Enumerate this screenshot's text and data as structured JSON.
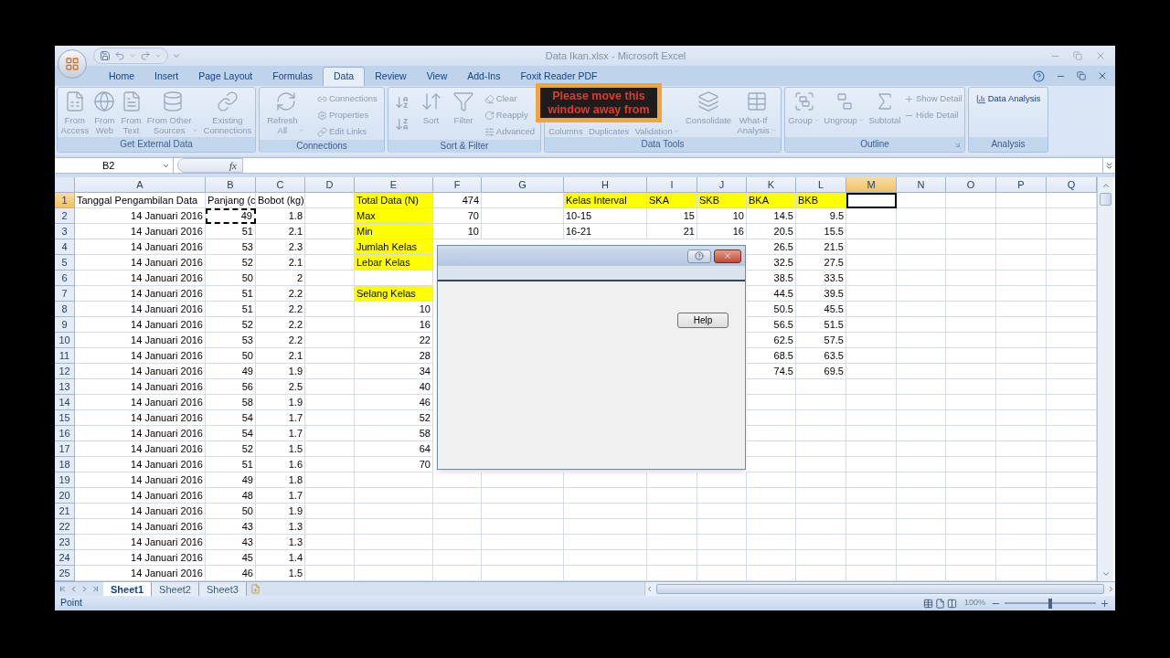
{
  "window": {
    "title": "Data Ikan.xlsx - Microsoft Excel"
  },
  "tabs": [
    {
      "label": "Home",
      "selected": false
    },
    {
      "label": "Insert",
      "selected": false
    },
    {
      "label": "Page Layout",
      "selected": false
    },
    {
      "label": "Formulas",
      "selected": false
    },
    {
      "label": "Data",
      "selected": true
    },
    {
      "label": "Review",
      "selected": false
    },
    {
      "label": "View",
      "selected": false
    },
    {
      "label": "Add-Ins",
      "selected": false
    },
    {
      "label": "Foxit Reader PDF",
      "selected": false
    }
  ],
  "ribbon": {
    "groups": [
      {
        "label": "Get External Data",
        "disabled": true,
        "items": [
          {
            "kind": "large",
            "label": "From\nAccess"
          },
          {
            "kind": "large",
            "label": "From\nWeb"
          },
          {
            "kind": "large",
            "label": "From\nText"
          },
          {
            "kind": "large",
            "label": "From Other\nSources",
            "menu": true
          },
          {
            "kind": "large",
            "label": "Existing\nConnections"
          }
        ]
      },
      {
        "label": "Connections",
        "disabled": true,
        "items": [
          {
            "kind": "large",
            "label": "Refresh\nAll",
            "menu": true
          },
          {
            "kind": "stack",
            "entries": [
              "Connections",
              "Properties",
              "Edit Links"
            ]
          }
        ]
      },
      {
        "label": "Sort & Filter",
        "disabled": true,
        "items": [
          {
            "kind": "sortpair"
          },
          {
            "kind": "large",
            "label": "Sort"
          },
          {
            "kind": "large",
            "label": "Filter"
          },
          {
            "kind": "stack",
            "entries": [
              "Clear",
              "Reapply",
              "Advanced"
            ]
          }
        ]
      },
      {
        "label": "Data Tools",
        "disabled": true,
        "items": [
          {
            "kind": "label",
            "label": "Columns"
          },
          {
            "kind": "label",
            "label": "Duplicates"
          },
          {
            "kind": "label",
            "label": "Validation",
            "menu": true
          },
          {
            "kind": "large",
            "label": "Consolidate"
          },
          {
            "kind": "large",
            "label": "What-If\nAnalysis",
            "menu": true
          }
        ]
      },
      {
        "label": "Outline",
        "disabled": true,
        "items": [
          {
            "kind": "large",
            "label": "Group",
            "menu": true
          },
          {
            "kind": "large",
            "label": "Ungroup",
            "menu": true
          },
          {
            "kind": "large",
            "label": "Subtotal"
          },
          {
            "kind": "stack",
            "entries": [
              "Show Detail",
              "Hide Detail"
            ]
          }
        ]
      },
      {
        "label": "Analysis",
        "disabled": false,
        "items": [
          {
            "kind": "stack",
            "entries": [
              "Data Analysis"
            ]
          }
        ]
      }
    ]
  },
  "overlay": {
    "lines": [
      "Please move this",
      "window away from"
    ]
  },
  "formula_bar": {
    "name_box": "B2",
    "function_label": "fx"
  },
  "columns": [
    {
      "label": "A",
      "selected": false
    },
    {
      "label": "B",
      "selected": false
    },
    {
      "label": "C",
      "selected": false
    },
    {
      "label": "D",
      "selected": false
    },
    {
      "label": "E",
      "selected": false
    },
    {
      "label": "F",
      "selected": false
    },
    {
      "label": "G",
      "selected": false
    },
    {
      "label": "H",
      "selected": false
    },
    {
      "label": "I",
      "selected": false
    },
    {
      "label": "J",
      "selected": false
    },
    {
      "label": "K",
      "selected": false
    },
    {
      "label": "L",
      "selected": false
    },
    {
      "label": "M",
      "selected": true
    },
    {
      "label": "N",
      "selected": false
    },
    {
      "label": "O",
      "selected": false
    },
    {
      "label": "P",
      "selected": false
    },
    {
      "label": "Q",
      "selected": false
    }
  ],
  "rows": [
    {
      "header": "1",
      "selected": true,
      "cells": [
        {
          "text": "Tanggal Pengambilan Data",
          "kind": "text"
        },
        {
          "text": "Panjang (c",
          "kind": "text"
        },
        {
          "text": "Bobot (kg)",
          "kind": "text"
        },
        null,
        {
          "text": "Total Data (N)",
          "kind": "text",
          "color": "#ffff00"
        },
        {
          "text": "474",
          "kind": "number"
        },
        null,
        {
          "text": "Kelas Interval",
          "kind": "text",
          "color": "#ffff00"
        },
        {
          "text": "SKA",
          "kind": "text",
          "color": "#ffff00"
        },
        {
          "text": "SKB",
          "kind": "text",
          "color": "#ffff00"
        },
        {
          "text": "BKA",
          "kind": "text",
          "color": "#ffff00"
        },
        {
          "text": "BKB",
          "kind": "text",
          "color": "#ffff00"
        },
        {
          "active": true
        }
      ]
    },
    {
      "header": "2",
      "selected": false,
      "cells": [
        {
          "text": "14 Januari 2016",
          "kind": "number"
        },
        {
          "text": "49",
          "kind": "number",
          "copied": true
        },
        {
          "text": "1.8",
          "kind": "number"
        },
        null,
        {
          "text": "Max",
          "kind": "text",
          "color": "#ffff00"
        },
        {
          "text": "70",
          "kind": "number"
        },
        null,
        {
          "text": "10-15",
          "kind": "text"
        },
        {
          "text": "15",
          "kind": "number"
        },
        {
          "text": "10",
          "kind": "number"
        },
        {
          "text": "14.5",
          "kind": "number"
        },
        {
          "text": "9.5",
          "kind": "number"
        }
      ]
    },
    {
      "header": "3",
      "selected": false,
      "cells": [
        {
          "text": "14 Januari 2016",
          "kind": "number"
        },
        {
          "text": "51",
          "kind": "number"
        },
        {
          "text": "2.1",
          "kind": "number"
        },
        null,
        {
          "text": "Min",
          "kind": "text",
          "color": "#ffff00"
        },
        {
          "text": "10",
          "kind": "number"
        },
        null,
        {
          "text": "16-21",
          "kind": "text"
        },
        {
          "text": "21",
          "kind": "number"
        },
        {
          "text": "16",
          "kind": "number"
        },
        {
          "text": "20.5",
          "kind": "number"
        },
        {
          "text": "15.5",
          "kind": "number"
        }
      ]
    },
    {
      "header": "4",
      "selected": false,
      "cells": [
        {
          "text": "14 Januari 2016",
          "kind": "number"
        },
        {
          "text": "53",
          "kind": "number"
        },
        {
          "text": "2.3",
          "kind": "number"
        },
        null,
        {
          "text": "Jumlah Kelas",
          "kind": "text",
          "color": "#ffff00"
        },
        null,
        null,
        null,
        null,
        null,
        {
          "text": "26.5",
          "kind": "number"
        },
        {
          "text": "21.5",
          "kind": "number"
        }
      ]
    },
    {
      "header": "5",
      "selected": false,
      "cells": [
        {
          "text": "14 Januari 2016",
          "kind": "number"
        },
        {
          "text": "52",
          "kind": "number"
        },
        {
          "text": "2.1",
          "kind": "number"
        },
        null,
        {
          "text": "Lebar Kelas",
          "kind": "text",
          "color": "#ffff00"
        },
        null,
        null,
        null,
        null,
        null,
        {
          "text": "32.5",
          "kind": "number"
        },
        {
          "text": "27.5",
          "kind": "number"
        }
      ]
    },
    {
      "header": "6",
      "selected": false,
      "cells": [
        {
          "text": "14 Januari 2016",
          "kind": "number"
        },
        {
          "text": "50",
          "kind": "number"
        },
        {
          "text": "2",
          "kind": "number"
        },
        null,
        null,
        null,
        null,
        null,
        null,
        null,
        {
          "text": "38.5",
          "kind": "number"
        },
        {
          "text": "33.5",
          "kind": "number"
        }
      ]
    },
    {
      "header": "7",
      "selected": false,
      "cells": [
        {
          "text": "14 Januari 2016",
          "kind": "number"
        },
        {
          "text": "51",
          "kind": "number"
        },
        {
          "text": "2.2",
          "kind": "number"
        },
        null,
        {
          "text": "Selang Kelas",
          "kind": "text",
          "color": "#ffff00"
        },
        null,
        null,
        null,
        null,
        null,
        {
          "text": "44.5",
          "kind": "number"
        },
        {
          "text": "39.5",
          "kind": "number"
        }
      ]
    },
    {
      "header": "8",
      "selected": false,
      "cells": [
        {
          "text": "14 Januari 2016",
          "kind": "number"
        },
        {
          "text": "51",
          "kind": "number"
        },
        {
          "text": "2.2",
          "kind": "number"
        },
        null,
        {
          "text": "10",
          "kind": "number"
        },
        null,
        null,
        null,
        null,
        null,
        {
          "text": "50.5",
          "kind": "number"
        },
        {
          "text": "45.5",
          "kind": "number"
        }
      ]
    },
    {
      "header": "9",
      "selected": false,
      "cells": [
        {
          "text": "14 Januari 2016",
          "kind": "number"
        },
        {
          "text": "52",
          "kind": "number"
        },
        {
          "text": "2.2",
          "kind": "number"
        },
        null,
        {
          "text": "16",
          "kind": "number"
        },
        null,
        null,
        null,
        null,
        null,
        {
          "text": "56.5",
          "kind": "number"
        },
        {
          "text": "51.5",
          "kind": "number"
        }
      ]
    },
    {
      "header": "10",
      "selected": false,
      "cells": [
        {
          "text": "14 Januari 2016",
          "kind": "number"
        },
        {
          "text": "53",
          "kind": "number"
        },
        {
          "text": "2.2",
          "kind": "number"
        },
        null,
        {
          "text": "22",
          "kind": "number"
        },
        null,
        null,
        null,
        null,
        null,
        {
          "text": "62.5",
          "kind": "number"
        },
        {
          "text": "57.5",
          "kind": "number"
        }
      ]
    },
    {
      "header": "11",
      "selected": false,
      "cells": [
        {
          "text": "14 Januari 2016",
          "kind": "number"
        },
        {
          "text": "50",
          "kind": "number"
        },
        {
          "text": "2.1",
          "kind": "number"
        },
        null,
        {
          "text": "28",
          "kind": "number"
        },
        null,
        null,
        null,
        null,
        null,
        {
          "text": "68.5",
          "kind": "number"
        },
        {
          "text": "63.5",
          "kind": "number"
        }
      ]
    },
    {
      "header": "12",
      "selected": false,
      "cells": [
        {
          "text": "14 Januari 2016",
          "kind": "number"
        },
        {
          "text": "49",
          "kind": "number"
        },
        {
          "text": "1.9",
          "kind": "number"
        },
        null,
        {
          "text": "34",
          "kind": "number"
        },
        null,
        null,
        null,
        null,
        null,
        {
          "text": "74.5",
          "kind": "number"
        },
        {
          "text": "69.5",
          "kind": "number"
        }
      ]
    },
    {
      "header": "13",
      "selected": false,
      "cells": [
        {
          "text": "14 Januari 2016",
          "kind": "number"
        },
        {
          "text": "56",
          "kind": "number"
        },
        {
          "text": "2.5",
          "kind": "number"
        },
        null,
        {
          "text": "40",
          "kind": "number"
        }
      ]
    },
    {
      "header": "14",
      "selected": false,
      "cells": [
        {
          "text": "14 Januari 2016",
          "kind": "number"
        },
        {
          "text": "58",
          "kind": "number"
        },
        {
          "text": "1.9",
          "kind": "number"
        },
        null,
        {
          "text": "46",
          "kind": "number"
        }
      ]
    },
    {
      "header": "15",
      "selected": false,
      "cells": [
        {
          "text": "14 Januari 2016",
          "kind": "number"
        },
        {
          "text": "54",
          "kind": "number"
        },
        {
          "text": "1.7",
          "kind": "number"
        },
        null,
        {
          "text": "52",
          "kind": "number"
        }
      ]
    },
    {
      "header": "16",
      "selected": false,
      "cells": [
        {
          "text": "14 Januari 2016",
          "kind": "number"
        },
        {
          "text": "54",
          "kind": "number"
        },
        {
          "text": "1.7",
          "kind": "number"
        },
        null,
        {
          "text": "58",
          "kind": "number"
        }
      ]
    },
    {
      "header": "17",
      "selected": false,
      "cells": [
        {
          "text": "14 Januari 2016",
          "kind": "number"
        },
        {
          "text": "52",
          "kind": "number"
        },
        {
          "text": "1.5",
          "kind": "number"
        },
        null,
        {
          "text": "64",
          "kind": "number"
        }
      ]
    },
    {
      "header": "18",
      "selected": false,
      "cells": [
        {
          "text": "14 Januari 2016",
          "kind": "number"
        },
        {
          "text": "51",
          "kind": "number"
        },
        {
          "text": "1.6",
          "kind": "number"
        },
        null,
        {
          "text": "70",
          "kind": "number"
        }
      ]
    },
    {
      "header": "19",
      "selected": false,
      "cells": [
        {
          "text": "14 Januari 2016",
          "kind": "number"
        },
        {
          "text": "49",
          "kind": "number"
        },
        {
          "text": "1.8",
          "kind": "number"
        }
      ]
    },
    {
      "header": "20",
      "selected": false,
      "cells": [
        {
          "text": "14 Januari 2016",
          "kind": "number"
        },
        {
          "text": "48",
          "kind": "number"
        },
        {
          "text": "1.7",
          "kind": "number"
        }
      ]
    },
    {
      "header": "21",
      "selected": false,
      "cells": [
        {
          "text": "14 Januari 2016",
          "kind": "number"
        },
        {
          "text": "50",
          "kind": "number"
        },
        {
          "text": "1.9",
          "kind": "number"
        }
      ]
    },
    {
      "header": "22",
      "selected": false,
      "cells": [
        {
          "text": "14 Januari 2016",
          "kind": "number"
        },
        {
          "text": "43",
          "kind": "number"
        },
        {
          "text": "1.3",
          "kind": "number"
        }
      ]
    },
    {
      "header": "23",
      "selected": false,
      "cells": [
        {
          "text": "14 Januari 2016",
          "kind": "number"
        },
        {
          "text": "43",
          "kind": "number"
        },
        {
          "text": "1.3",
          "kind": "number"
        }
      ]
    },
    {
      "header": "24",
      "selected": false,
      "cells": [
        {
          "text": "14 Januari 2016",
          "kind": "number"
        },
        {
          "text": "45",
          "kind": "number"
        },
        {
          "text": "1.4",
          "kind": "number"
        }
      ]
    },
    {
      "header": "25",
      "selected": false,
      "cells": [
        {
          "text": "14 Januari 2016",
          "kind": "number"
        },
        {
          "text": "46",
          "kind": "number"
        },
        {
          "text": "1.5",
          "kind": "number"
        }
      ]
    }
  ],
  "dialog": {
    "help_button": "Help"
  },
  "sheet_tabs": [
    {
      "label": "Sheet1",
      "selected": true
    },
    {
      "label": "Sheet2",
      "selected": false
    },
    {
      "label": "Sheet3",
      "selected": false
    }
  ],
  "status_bar": {
    "mode": "Point",
    "zoom": {
      "label": "100%",
      "level": 0.5
    }
  }
}
